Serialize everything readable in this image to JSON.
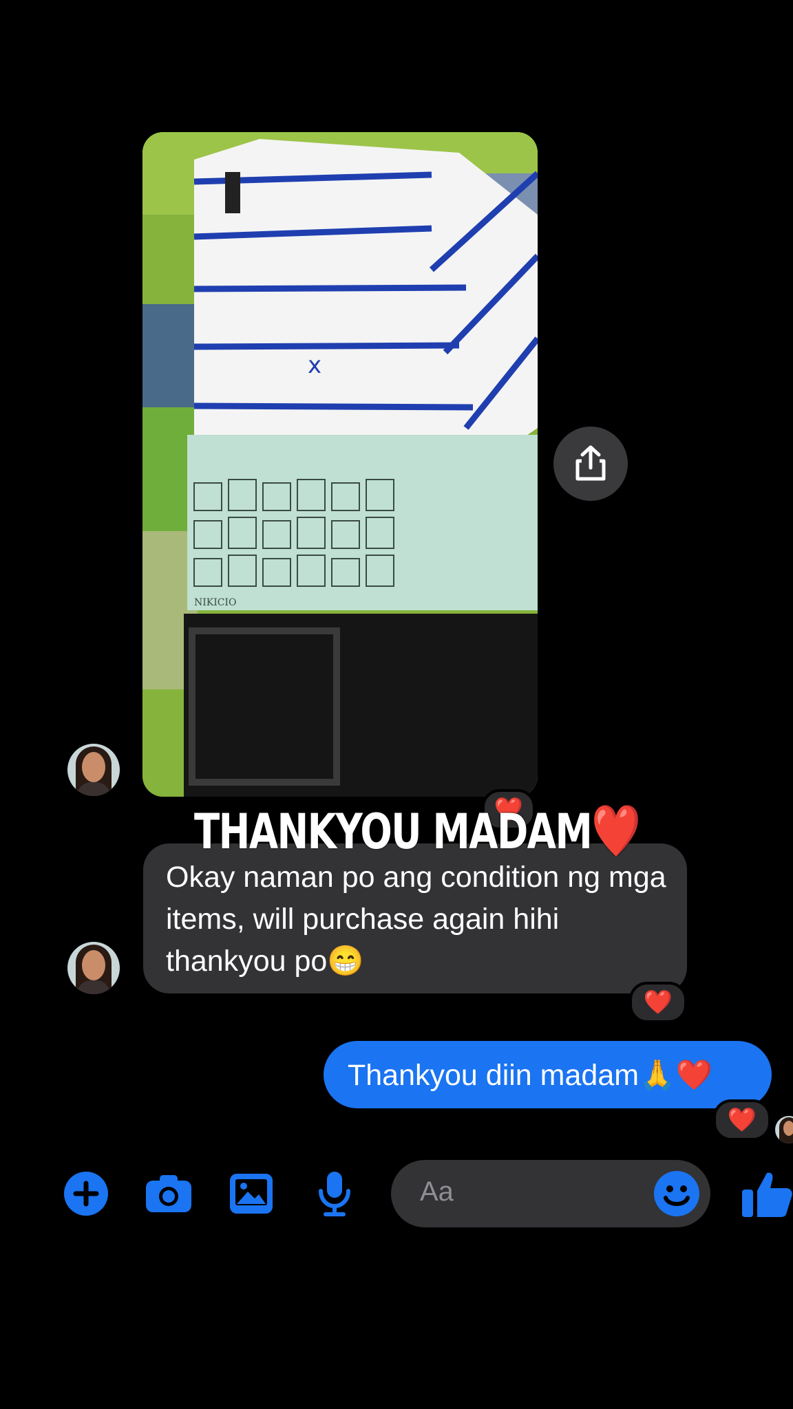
{
  "caption": {
    "text": "THANKYOU MADAM",
    "emoji": "❤️"
  },
  "messages": {
    "received": {
      "text": "Okay naman po ang condition ng mga items, will purchase again hihi thankyou po😁",
      "reaction": "❤️"
    },
    "sent": {
      "text": "Thankyou diin madam🙏❤️",
      "reaction": "❤️"
    },
    "photo_reaction": "❤️"
  },
  "photo": {
    "print_text": "NIKICIO"
  },
  "composer": {
    "placeholder": "Aa"
  },
  "colors": {
    "accent": "#1b74f1",
    "bubble_in": "#333336",
    "background": "#000000",
    "heart": "#ff1e3c"
  },
  "icons": [
    "plus-icon",
    "camera-icon",
    "gallery-icon",
    "microphone-icon",
    "emoji-icon",
    "thumbs-up-icon",
    "share-icon"
  ]
}
